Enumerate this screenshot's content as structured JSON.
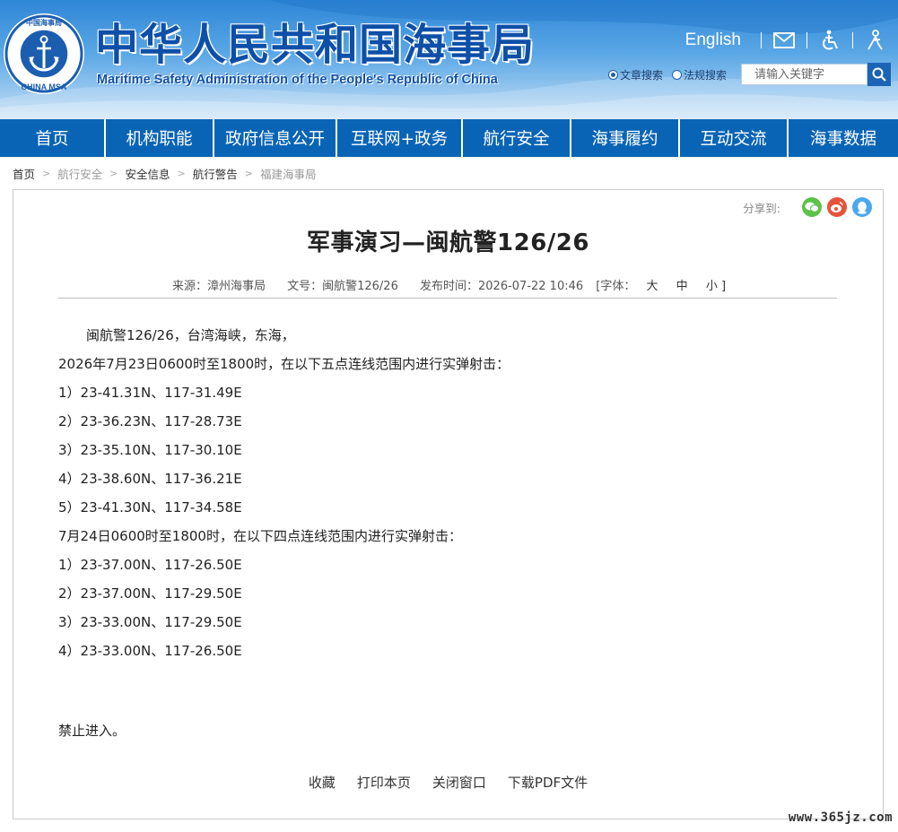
{
  "header": {
    "logo_text_top": "中国海事局",
    "logo_text_bottom": "CHINA MSA",
    "title": "中华人民共和国海事局",
    "subtitle": "Maritime Safety Administration of the People's Republic of China",
    "english_link": "English",
    "icons": [
      "mail-icon",
      "accessibility-icon",
      "elderly-mode-icon"
    ],
    "search": {
      "options": [
        {
          "label": "文章搜索",
          "selected": true
        },
        {
          "label": "法规搜索",
          "selected": false
        }
      ],
      "placeholder": "请输入关键字"
    }
  },
  "nav": {
    "items": [
      {
        "label": "首页",
        "width": 118
      },
      {
        "label": "机构职能",
        "width": 121
      },
      {
        "label": "政府信息公开",
        "width": 137
      },
      {
        "label": "互联网+政务",
        "width": 140
      },
      {
        "label": "航行安全",
        "width": 121
      },
      {
        "label": "海事履约",
        "width": 121
      },
      {
        "label": "互动交流",
        "width": 121
      },
      {
        "label": "海事数据",
        "width": 122
      }
    ]
  },
  "breadcrumb": [
    {
      "label": "首页",
      "dark": true
    },
    {
      "label": "航行安全",
      "dark": false
    },
    {
      "label": "安全信息",
      "dark": true
    },
    {
      "label": "航行警告",
      "dark": true
    },
    {
      "label": "福建海事局",
      "dark": false
    }
  ],
  "share": {
    "label": "分享到:"
  },
  "article": {
    "title": "军事演习—闽航警126/26",
    "meta": {
      "source": "来源：漳州海事局",
      "doc_no": "文号：闽航警126/26",
      "published": "发布时间：2026-07-22 10:46",
      "font_label": "[字体：",
      "font_large": "大",
      "font_medium": "中",
      "font_small": "小 ]"
    },
    "lines": [
      "闽航警126/26，台湾海峡，东海，",
      "2026年7月23日0600时至1800时，在以下五点连线范围内进行实弹射击：",
      "1）23-41.31N、117-31.49E",
      "2）23-36.23N、117-28.73E",
      "3）23-35.10N、117-30.10E",
      "4）23-38.60N、117-36.21E",
      "5）23-41.30N、117-34.58E",
      "7月24日0600时至1800时，在以下四点连线范围内进行实弹射击：",
      "1）23-37.00N、117-26.50E",
      "2）23-37.00N、117-29.50E",
      "3）23-33.00N、117-29.50E",
      "4）23-33.00N、117-26.50E"
    ],
    "closing": "禁止进入。",
    "actions": [
      "收藏",
      "打印本页",
      "关闭窗口",
      "下载PDF文件"
    ]
  },
  "watermark": "www.365jz.com",
  "colors": {
    "nav_bg": "#0a64b6",
    "title_blue": "#0e4fa8",
    "wechat": "#5cc24a",
    "weibo": "#e6533b",
    "qq": "#4aa8ef"
  }
}
